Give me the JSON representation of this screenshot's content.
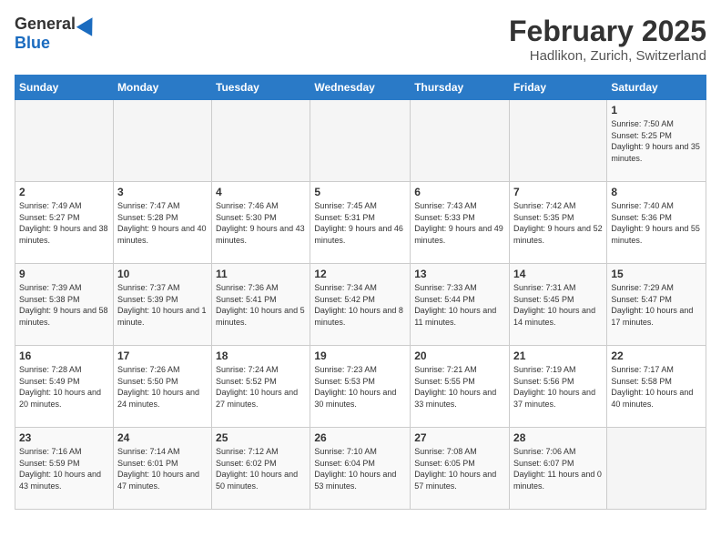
{
  "header": {
    "logo_general": "General",
    "logo_blue": "Blue",
    "title": "February 2025",
    "subtitle": "Hadlikon, Zurich, Switzerland"
  },
  "days_of_week": [
    "Sunday",
    "Monday",
    "Tuesday",
    "Wednesday",
    "Thursday",
    "Friday",
    "Saturday"
  ],
  "weeks": [
    [
      {
        "day": "",
        "info": ""
      },
      {
        "day": "",
        "info": ""
      },
      {
        "day": "",
        "info": ""
      },
      {
        "day": "",
        "info": ""
      },
      {
        "day": "",
        "info": ""
      },
      {
        "day": "",
        "info": ""
      },
      {
        "day": "1",
        "info": "Sunrise: 7:50 AM\nSunset: 5:25 PM\nDaylight: 9 hours and 35 minutes."
      }
    ],
    [
      {
        "day": "2",
        "info": "Sunrise: 7:49 AM\nSunset: 5:27 PM\nDaylight: 9 hours and 38 minutes."
      },
      {
        "day": "3",
        "info": "Sunrise: 7:47 AM\nSunset: 5:28 PM\nDaylight: 9 hours and 40 minutes."
      },
      {
        "day": "4",
        "info": "Sunrise: 7:46 AM\nSunset: 5:30 PM\nDaylight: 9 hours and 43 minutes."
      },
      {
        "day": "5",
        "info": "Sunrise: 7:45 AM\nSunset: 5:31 PM\nDaylight: 9 hours and 46 minutes."
      },
      {
        "day": "6",
        "info": "Sunrise: 7:43 AM\nSunset: 5:33 PM\nDaylight: 9 hours and 49 minutes."
      },
      {
        "day": "7",
        "info": "Sunrise: 7:42 AM\nSunset: 5:35 PM\nDaylight: 9 hours and 52 minutes."
      },
      {
        "day": "8",
        "info": "Sunrise: 7:40 AM\nSunset: 5:36 PM\nDaylight: 9 hours and 55 minutes."
      }
    ],
    [
      {
        "day": "9",
        "info": "Sunrise: 7:39 AM\nSunset: 5:38 PM\nDaylight: 9 hours and 58 minutes."
      },
      {
        "day": "10",
        "info": "Sunrise: 7:37 AM\nSunset: 5:39 PM\nDaylight: 10 hours and 1 minute."
      },
      {
        "day": "11",
        "info": "Sunrise: 7:36 AM\nSunset: 5:41 PM\nDaylight: 10 hours and 5 minutes."
      },
      {
        "day": "12",
        "info": "Sunrise: 7:34 AM\nSunset: 5:42 PM\nDaylight: 10 hours and 8 minutes."
      },
      {
        "day": "13",
        "info": "Sunrise: 7:33 AM\nSunset: 5:44 PM\nDaylight: 10 hours and 11 minutes."
      },
      {
        "day": "14",
        "info": "Sunrise: 7:31 AM\nSunset: 5:45 PM\nDaylight: 10 hours and 14 minutes."
      },
      {
        "day": "15",
        "info": "Sunrise: 7:29 AM\nSunset: 5:47 PM\nDaylight: 10 hours and 17 minutes."
      }
    ],
    [
      {
        "day": "16",
        "info": "Sunrise: 7:28 AM\nSunset: 5:49 PM\nDaylight: 10 hours and 20 minutes."
      },
      {
        "day": "17",
        "info": "Sunrise: 7:26 AM\nSunset: 5:50 PM\nDaylight: 10 hours and 24 minutes."
      },
      {
        "day": "18",
        "info": "Sunrise: 7:24 AM\nSunset: 5:52 PM\nDaylight: 10 hours and 27 minutes."
      },
      {
        "day": "19",
        "info": "Sunrise: 7:23 AM\nSunset: 5:53 PM\nDaylight: 10 hours and 30 minutes."
      },
      {
        "day": "20",
        "info": "Sunrise: 7:21 AM\nSunset: 5:55 PM\nDaylight: 10 hours and 33 minutes."
      },
      {
        "day": "21",
        "info": "Sunrise: 7:19 AM\nSunset: 5:56 PM\nDaylight: 10 hours and 37 minutes."
      },
      {
        "day": "22",
        "info": "Sunrise: 7:17 AM\nSunset: 5:58 PM\nDaylight: 10 hours and 40 minutes."
      }
    ],
    [
      {
        "day": "23",
        "info": "Sunrise: 7:16 AM\nSunset: 5:59 PM\nDaylight: 10 hours and 43 minutes."
      },
      {
        "day": "24",
        "info": "Sunrise: 7:14 AM\nSunset: 6:01 PM\nDaylight: 10 hours and 47 minutes."
      },
      {
        "day": "25",
        "info": "Sunrise: 7:12 AM\nSunset: 6:02 PM\nDaylight: 10 hours and 50 minutes."
      },
      {
        "day": "26",
        "info": "Sunrise: 7:10 AM\nSunset: 6:04 PM\nDaylight: 10 hours and 53 minutes."
      },
      {
        "day": "27",
        "info": "Sunrise: 7:08 AM\nSunset: 6:05 PM\nDaylight: 10 hours and 57 minutes."
      },
      {
        "day": "28",
        "info": "Sunrise: 7:06 AM\nSunset: 6:07 PM\nDaylight: 11 hours and 0 minutes."
      },
      {
        "day": "",
        "info": ""
      }
    ]
  ]
}
